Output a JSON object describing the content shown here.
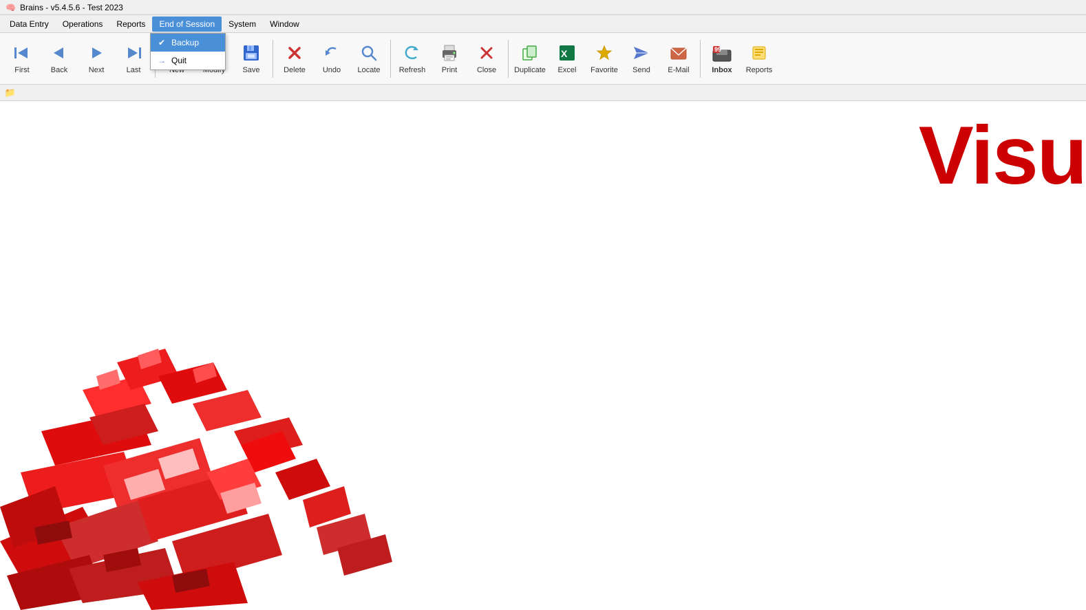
{
  "titleBar": {
    "icon": "🧠",
    "title": "Brains - v5.4.5.6 - Test 2023"
  },
  "menuBar": {
    "items": [
      {
        "id": "data-entry",
        "label": "Data Entry",
        "active": false
      },
      {
        "id": "operations",
        "label": "Operations",
        "active": false
      },
      {
        "id": "reports",
        "label": "Reports",
        "active": false
      },
      {
        "id": "end-of-session",
        "label": "End of Session",
        "active": true
      },
      {
        "id": "system",
        "label": "System",
        "active": false
      },
      {
        "id": "window",
        "label": "Window",
        "active": false
      }
    ],
    "dropdown": {
      "items": [
        {
          "id": "backup",
          "label": "Backup",
          "icon": "✔",
          "highlighted": true
        },
        {
          "id": "quit",
          "label": "Quit",
          "icon": "→",
          "highlighted": false
        }
      ]
    }
  },
  "toolbar": {
    "buttons": [
      {
        "id": "first",
        "label": "First",
        "icon": "first"
      },
      {
        "id": "back",
        "label": "Back",
        "icon": "back"
      },
      {
        "id": "next",
        "label": "Next",
        "icon": "next"
      },
      {
        "id": "last",
        "label": "Last",
        "icon": "last"
      },
      {
        "separator1": true
      },
      {
        "id": "new",
        "label": "New",
        "icon": "new"
      },
      {
        "id": "modify",
        "label": "Modify",
        "icon": "modify"
      },
      {
        "id": "save",
        "label": "Save",
        "icon": "save"
      },
      {
        "separator2": true
      },
      {
        "id": "delete",
        "label": "Delete",
        "icon": "delete"
      },
      {
        "id": "undo",
        "label": "Undo",
        "icon": "undo"
      },
      {
        "id": "locate",
        "label": "Locate",
        "icon": "locate"
      },
      {
        "separator3": true
      },
      {
        "id": "refresh",
        "label": "Refresh",
        "icon": "refresh"
      },
      {
        "id": "print",
        "label": "Print",
        "icon": "print"
      },
      {
        "id": "close",
        "label": "Close",
        "icon": "close"
      },
      {
        "separator4": true
      },
      {
        "id": "duplicate",
        "label": "Duplicate",
        "icon": "duplicate"
      },
      {
        "id": "excel",
        "label": "Excel",
        "icon": "excel"
      },
      {
        "id": "favorite",
        "label": "Favorite",
        "icon": "favorite"
      },
      {
        "id": "send",
        "label": "Send",
        "icon": "send"
      },
      {
        "id": "email",
        "label": "E-Mail",
        "icon": "email"
      },
      {
        "separator5": true
      },
      {
        "id": "inbox",
        "label": "Inbox",
        "icon": "inbox",
        "bold": true
      },
      {
        "id": "reports",
        "label": "Reports",
        "icon": "reports"
      }
    ]
  },
  "quickAccess": {
    "icon": "📁"
  },
  "mainContent": {
    "visuText": "Visu"
  }
}
